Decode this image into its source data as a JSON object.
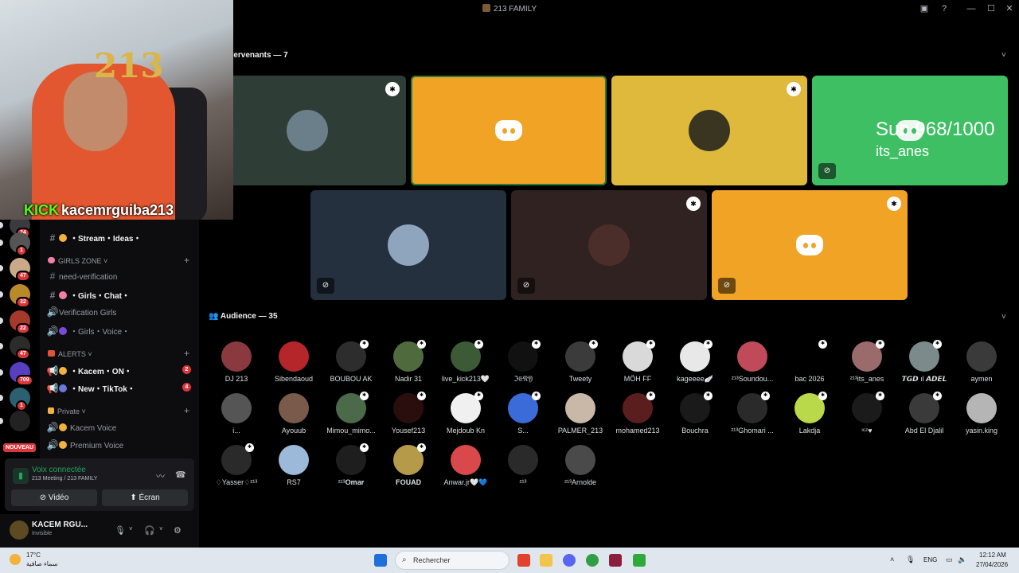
{
  "window": {
    "title": "213 FAMILY",
    "controls": [
      "Inbox",
      "Aide",
      "Réduire",
      "Agrandir",
      "Fermer"
    ]
  },
  "servers": [
    {
      "badge": "24",
      "color": "#3a3a40"
    },
    {
      "badge": "1",
      "color": "#555"
    },
    {
      "badge": "47",
      "color": "#c9a98a"
    },
    {
      "badge": "32",
      "color": "#b88a2a"
    },
    {
      "badge": "22",
      "color": "#a53a2a"
    },
    {
      "badge": "47",
      "color": "#2b2b2b"
    },
    {
      "badge": "709",
      "color": "#5a3ec2"
    },
    {
      "badge": "1",
      "color": "#2c6070"
    },
    {
      "badge": "",
      "color": "#222"
    }
  ],
  "nouveau_label": "NOUVEAU",
  "channels": {
    "stream_ideas": "・Stream・Ideas・",
    "girls_zone": "GIRLS ZONE",
    "need_verification": "need-verification",
    "girls_chat": "・Girls・Chat・",
    "verification_girls": "Verification Girls",
    "girls_voice": "・Girls・Voice・",
    "alerts": "ALERTS",
    "kacem_on": "・Kacem・ON・",
    "kacem_on_badge": "2",
    "new_tiktok": "・New・TikTok・",
    "new_tiktok_badge": "4",
    "private": "Private",
    "kacem_voice": "Kacem Voice",
    "premium_voice": "Premium Voice"
  },
  "voice": {
    "status": "Voix connectée",
    "location": "213 Meeting / 213 FAMILY",
    "video_label": "Vidéo",
    "screen_label": "Écran"
  },
  "user": {
    "name": "KACEM RGU...",
    "status": "Invisible"
  },
  "stage": {
    "speakers_title": "tervenants — 7",
    "audience_title": "Audience — 35",
    "overlay_text": "Sub 968/1000",
    "overlay_name": "its_anes"
  },
  "speakers": [
    {
      "bg": "#2f3d37",
      "type": "avatar",
      "avatar": "#6b7f8a",
      "mod": true,
      "mute": false
    },
    {
      "bg": "#f1a326",
      "type": "logo",
      "mod": false,
      "mute": false,
      "active": true
    },
    {
      "bg": "#dfb93c",
      "type": "avatar",
      "avatar": "#3a3520",
      "mod": true,
      "mute": false
    },
    {
      "bg": "#3ebf63",
      "type": "text",
      "mod": false,
      "mute": true
    },
    {
      "bg": "#24303e",
      "type": "avatar",
      "avatar": "#8fa5bd",
      "mod": false,
      "mute": true
    },
    {
      "bg": "#302220",
      "type": "avatar",
      "avatar": "#4b2e2a",
      "mod": true,
      "mute": true
    },
    {
      "bg": "#f1a326",
      "type": "logo",
      "mod": true,
      "mute": true
    }
  ],
  "audience": [
    {
      "name": "DJ 213",
      "color": "#8a3a3e",
      "mod": false
    },
    {
      "name": "Sibendaoud",
      "color": "#b5262b",
      "mod": false
    },
    {
      "name": "BOUBOU AK",
      "color": "#2d2d2d",
      "mod": true
    },
    {
      "name": "Nadir 31",
      "color": "#4f6b3d",
      "mod": true
    },
    {
      "name": "live_kick213🤍",
      "color": "#3b5a35",
      "mod": true
    },
    {
      "name": "ℑ𝔈𝔑𝔜",
      "color": "#111",
      "mod": true
    },
    {
      "name": "Tweety",
      "color": "#3b3b3b",
      "mod": true
    },
    {
      "name": "MÖH FF",
      "color": "#d9d9d9",
      "mod": true
    },
    {
      "name": "kageeee🪽",
      "color": "#e8e8e8",
      "mod": true
    },
    {
      "name": "²¹³Soundou...",
      "color": "#c04a5a",
      "mod": false
    },
    {
      "name": "bac 2026",
      "color": "#000",
      "mod": true
    },
    {
      "name": "²¹³its_anes",
      "color": "#9b6a6a",
      "mod": true
    },
    {
      "name": "𝙏𝙂𝘿 ıl 𝘼𝘿𝙀𝙇",
      "color": "#7b8a8a",
      "mod": true
    },
    {
      "name": "aymen",
      "color": "#3a3a3a",
      "mod": false
    },
    {
      "name": "i...",
      "color": "#555",
      "mod": false
    },
    {
      "name": "Ayouub",
      "color": "#7a5a4a",
      "mod": false
    },
    {
      "name": "Mimou_mimo...",
      "color": "#4a6a4a",
      "mod": true
    },
    {
      "name": "Yousef213",
      "color": "#2a0e0e",
      "mod": true
    },
    {
      "name": "Mejdoub Kn",
      "color": "#f0f0f0",
      "mod": true
    },
    {
      "name": "S...",
      "color": "#3b6ad9",
      "mod": true
    },
    {
      "name": "PALMER_213",
      "color": "#c9b8a8",
      "mod": false
    },
    {
      "name": "mohamed213",
      "color": "#5a1e1e",
      "mod": true
    },
    {
      "name": "Bouchra",
      "color": "#1a1a1a",
      "mod": true
    },
    {
      "name": "²¹³Ghomari ...",
      "color": "#2a2a2a",
      "mod": true
    },
    {
      "name": "Lakdja",
      "color": "#b9d94a",
      "mod": true
    },
    {
      "name": "ᶦᶜᶻ♥",
      "color": "#1b1b1b",
      "mod": true
    },
    {
      "name": "Abd El Djalil",
      "color": "#3a3a3a",
      "mod": true
    },
    {
      "name": "yasin.king",
      "color": "#b5b5b5",
      "mod": false
    },
    {
      "name": "♢Yasser♢²¹³",
      "color": "#2a2a2a",
      "mod": true
    },
    {
      "name": "RS7",
      "color": "#9db9d9",
      "mod": false
    },
    {
      "name": "²¹³𝐎𝐦𝐚𝐫",
      "color": "#1e1e1e",
      "mod": true
    },
    {
      "name": "𝐅𝐎𝐔𝐀𝐃",
      "color": "#b59a4a",
      "mod": true
    },
    {
      "name": "Anwar.jr🤍💙",
      "color": "#d9484a",
      "mod": false
    },
    {
      "name": "²¹³",
      "color": "#2a2a2a",
      "mod": false
    },
    {
      "name": "²¹³Arnolde",
      "color": "#4a4a4a",
      "mod": false
    }
  ],
  "webcam": {
    "kick_word": "KICK",
    "channel": "kacemrguiba213",
    "balloon": "213"
  },
  "taskbar": {
    "temperature": "17°C",
    "weather_desc": "سماء صافية",
    "search_placeholder": "Rechercher",
    "language": "ENG",
    "time": "12:12 AM",
    "date": "27/04/2026"
  }
}
